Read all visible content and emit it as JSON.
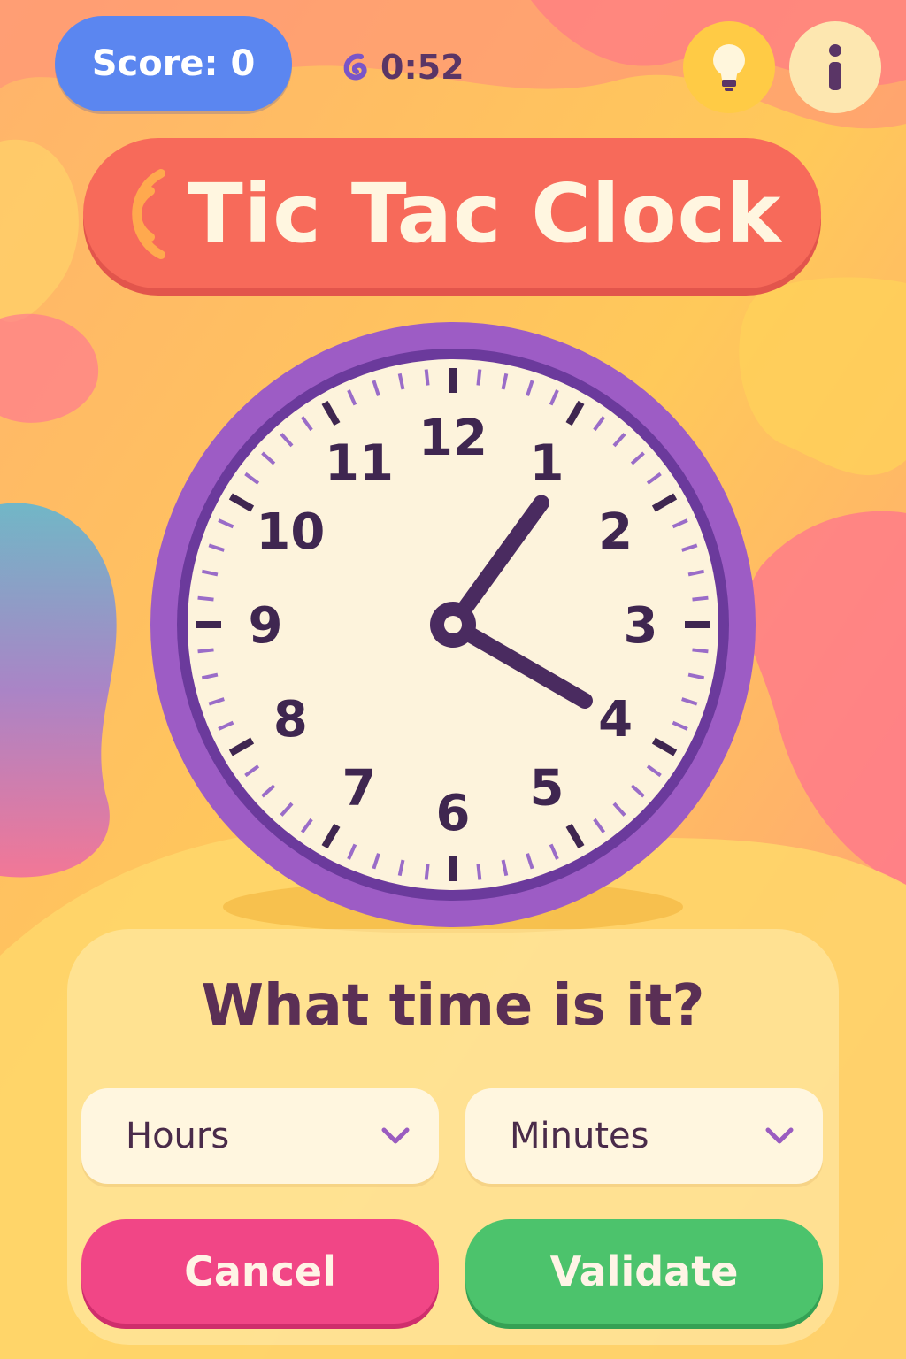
{
  "hud": {
    "score_label": "Score: 0",
    "timer_text": "0:52",
    "timer_icon": "timer-swirl-icon",
    "hint_icon": "lightbulb-icon",
    "info_icon": "info-icon"
  },
  "title": "Tic Tac Clock",
  "clock": {
    "numerals": [
      "12",
      "1",
      "2",
      "3",
      "4",
      "5",
      "6",
      "7",
      "8",
      "9",
      "10",
      "11"
    ],
    "hour_hand_angle_deg": 36,
    "minute_hand_angle_deg": 120
  },
  "question": "What time is it?",
  "selects": {
    "hours_label": "Hours",
    "minutes_label": "Minutes"
  },
  "actions": {
    "cancel_label": "Cancel",
    "validate_label": "Validate"
  },
  "colors": {
    "score": "#5b86f0",
    "title_banner": "#f76a5a",
    "clock_frame": "#9d5cc5",
    "cancel": "#f14686",
    "validate": "#4cc36c"
  }
}
